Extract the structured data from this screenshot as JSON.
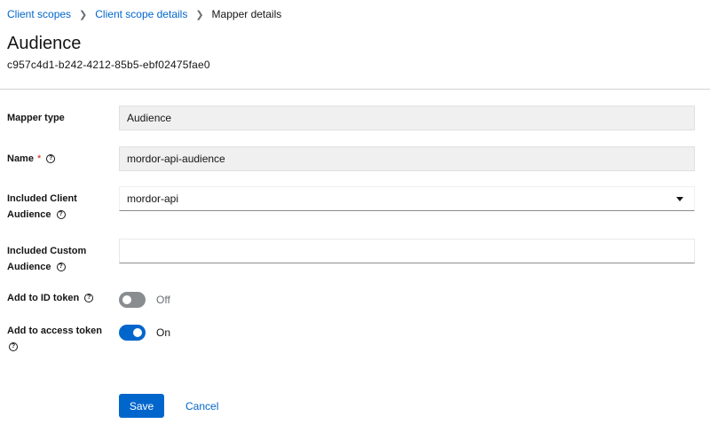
{
  "breadcrumb": {
    "items": [
      "Client scopes",
      "Client scope details"
    ],
    "current": "Mapper details"
  },
  "header": {
    "title": "Audience",
    "subtitle": "c957c4d1-b242-4212-85b5-ebf02475fae0"
  },
  "form": {
    "mapper_type": {
      "label": "Mapper type",
      "value": "Audience"
    },
    "name": {
      "label": "Name",
      "required_mark": "*",
      "value": "mordor-api-audience"
    },
    "included_client_audience": {
      "label_line1": "Included Client",
      "label_line2": "Audience",
      "value": "mordor-api"
    },
    "included_custom_audience": {
      "label_line1": "Included Custom",
      "label_line2": "Audience",
      "value": ""
    },
    "add_to_id_token": {
      "label": "Add to ID token",
      "state": "Off"
    },
    "add_to_access_token": {
      "label": "Add to access token",
      "state": "On"
    }
  },
  "actions": {
    "save_label": "Save",
    "cancel_label": "Cancel"
  },
  "colors": {
    "accent": "#0066cc",
    "required": "#c9190b",
    "readonly_bg": "#f0f0f0"
  }
}
